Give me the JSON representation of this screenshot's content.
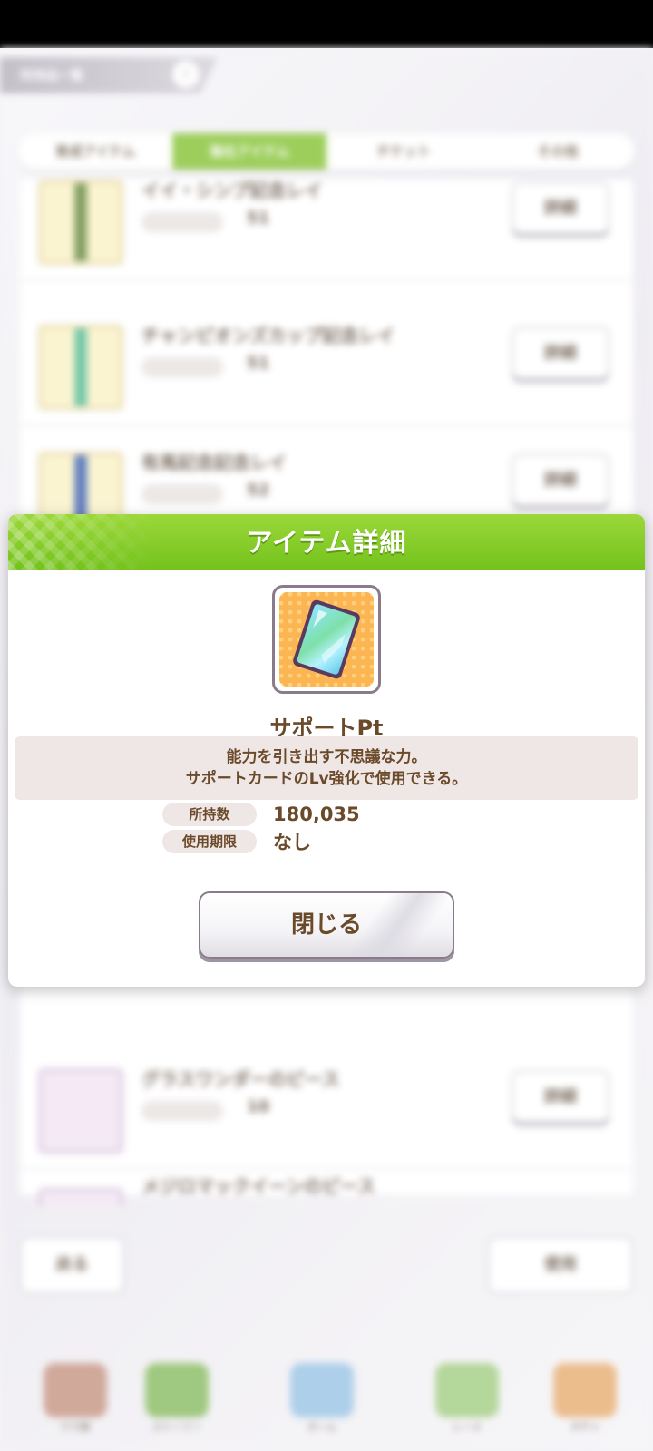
{
  "background": {
    "header_label": "所持品一覧",
    "header_count": "i",
    "tabs": [
      "育成アイテム",
      "強化アイテム",
      "チケット",
      "その他"
    ],
    "rows": [
      {
        "name": "イイ・シンプ記念レイ",
        "qty": "51",
        "button": "詳細"
      },
      {
        "name": "チャンピオンズカップ記念レイ",
        "qty": "51",
        "button": "詳細"
      },
      {
        "name": "有馬記念記念レイ",
        "qty": "52",
        "button": "詳細"
      },
      {
        "name": "グラスワンダーのピース",
        "qty": "10",
        "button": "詳細"
      },
      {
        "name": "メジロマックイーンのピース",
        "qty": "",
        "button": "詳細"
      }
    ],
    "back_label": "戻る",
    "use_label": "使用",
    "nav": [
      "ウマ娘",
      "ストーリー",
      "ホーム",
      "レース",
      "ガチャ"
    ]
  },
  "dialog": {
    "title": "アイテム詳細",
    "item_name": "サポートPt",
    "description_line1": "能力を引き出す不思議な力。",
    "description_line2": "サポートカードのLv強化で使用できる。",
    "owned_label": "所持数",
    "owned_value": "180,035",
    "expiry_label": "使用期限",
    "expiry_value": "なし",
    "close_label": "閉じる",
    "accent_color": "#7cc624"
  }
}
